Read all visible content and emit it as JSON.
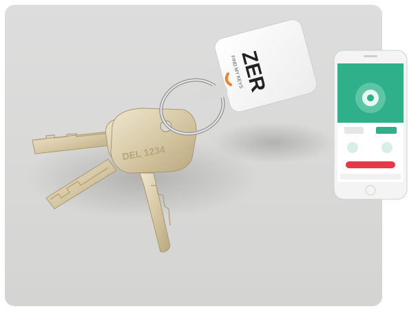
{
  "product": {
    "brand_text": "ZER",
    "tag_subtext": "FIND MY KEYS",
    "key_stamp": "DEL 1234"
  },
  "colors": {
    "background": "#d9d9d8",
    "phone_screen_accent": "#2fb08a",
    "phone_button_red": "#e5394a",
    "brand_orange": "#f0822d"
  },
  "icons": [
    "key-icon",
    "ring-icon",
    "tracker-tag-icon",
    "smartphone-icon"
  ]
}
